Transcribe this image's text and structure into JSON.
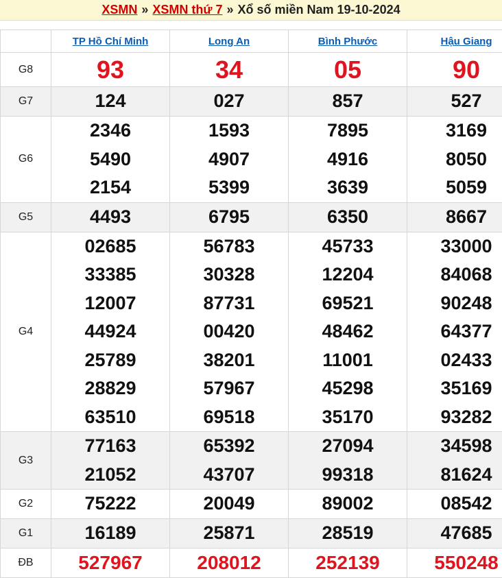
{
  "breadcrumb": {
    "link1": "XSMN",
    "sep1": "»",
    "link2": "XSMN thứ 7",
    "sep2": "»",
    "title": "Xổ số miền Nam 19-10-2024"
  },
  "provinces": [
    "TP Hồ Chí Minh",
    "Long An",
    "Bình Phước",
    "Hậu Giang"
  ],
  "prizes": [
    {
      "label": "G8",
      "results": [
        [
          "93"
        ],
        [
          "34"
        ],
        [
          "05"
        ],
        [
          "90"
        ]
      ]
    },
    {
      "label": "G7",
      "results": [
        [
          "124"
        ],
        [
          "027"
        ],
        [
          "857"
        ],
        [
          "527"
        ]
      ]
    },
    {
      "label": "G6",
      "results": [
        [
          "2346",
          "5490",
          "2154"
        ],
        [
          "1593",
          "4907",
          "5399"
        ],
        [
          "7895",
          "4916",
          "3639"
        ],
        [
          "3169",
          "8050",
          "5059"
        ]
      ]
    },
    {
      "label": "G5",
      "results": [
        [
          "4493"
        ],
        [
          "6795"
        ],
        [
          "6350"
        ],
        [
          "8667"
        ]
      ]
    },
    {
      "label": "G4",
      "results": [
        [
          "02685",
          "33385",
          "12007",
          "44924",
          "25789",
          "28829",
          "63510"
        ],
        [
          "56783",
          "30328",
          "87731",
          "00420",
          "38201",
          "57967",
          "69518"
        ],
        [
          "45733",
          "12204",
          "69521",
          "48462",
          "11001",
          "45298",
          "35170"
        ],
        [
          "33000",
          "84068",
          "90248",
          "64377",
          "02433",
          "35169",
          "93282"
        ]
      ]
    },
    {
      "label": "G3",
      "results": [
        [
          "77163",
          "21052"
        ],
        [
          "65392",
          "43707"
        ],
        [
          "27094",
          "99318"
        ],
        [
          "34598",
          "81624"
        ]
      ]
    },
    {
      "label": "G2",
      "results": [
        [
          "75222"
        ],
        [
          "20049"
        ],
        [
          "89002"
        ],
        [
          "08542"
        ]
      ]
    },
    {
      "label": "G1",
      "results": [
        [
          "16189"
        ],
        [
          "25871"
        ],
        [
          "28519"
        ],
        [
          "47685"
        ]
      ]
    },
    {
      "label": "ĐB",
      "results": [
        [
          "527967"
        ],
        [
          "208012"
        ],
        [
          "252139"
        ],
        [
          "550248"
        ]
      ]
    }
  ],
  "colors": {
    "accent_red": "#e0141e",
    "link_blue": "#0a5db4",
    "header_bg": "#fdf8d4"
  }
}
